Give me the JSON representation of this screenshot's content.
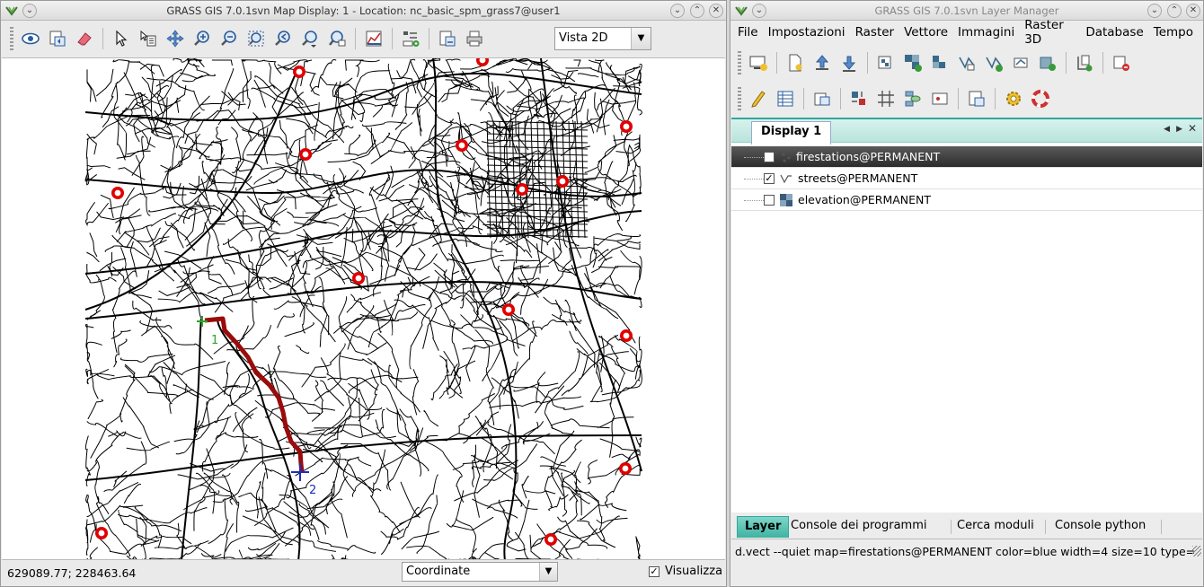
{
  "map_display": {
    "title": "GRASS GIS 7.0.1svn Map Display: 1  - Location: nc_basic_spm_grass7@user1",
    "view_mode": "Vista 2D",
    "coordinates": "629089.77; 228463.64",
    "statusbar_mode": "Coordinate",
    "render_label": "Visualizza",
    "render_checked": true,
    "route": {
      "start_label": "1",
      "end_label": "2"
    },
    "colors": {
      "route": "#9a0b0b",
      "firestation": "#e00000",
      "start_marker": "#2fa32f",
      "end_marker": "#1a2fbf"
    }
  },
  "layer_manager": {
    "title": "GRASS GIS 7.0.1svn Layer Manager",
    "menu": [
      "File",
      "Impostazioni",
      "Raster",
      "Vettore",
      "Immagini",
      "Raster 3D",
      "Database",
      "Tempo"
    ],
    "display_tab": "Display 1",
    "layers": [
      {
        "name": "firestations@PERMANENT",
        "checked": true,
        "selected": true,
        "icon": "vector-point-icon"
      },
      {
        "name": "streets@PERMANENT",
        "checked": true,
        "selected": false,
        "icon": "vector-line-icon"
      },
      {
        "name": "elevation@PERMANENT",
        "checked": false,
        "selected": false,
        "icon": "raster-icon"
      }
    ],
    "bottom_tabs": [
      "Layer",
      "Console dei programmi",
      "Cerca moduli",
      "Console python"
    ],
    "command": "d.vect --quiet map=firestations@PERMANENT color=blue width=4 size=10 type=",
    "accent": "#2fa89a"
  }
}
